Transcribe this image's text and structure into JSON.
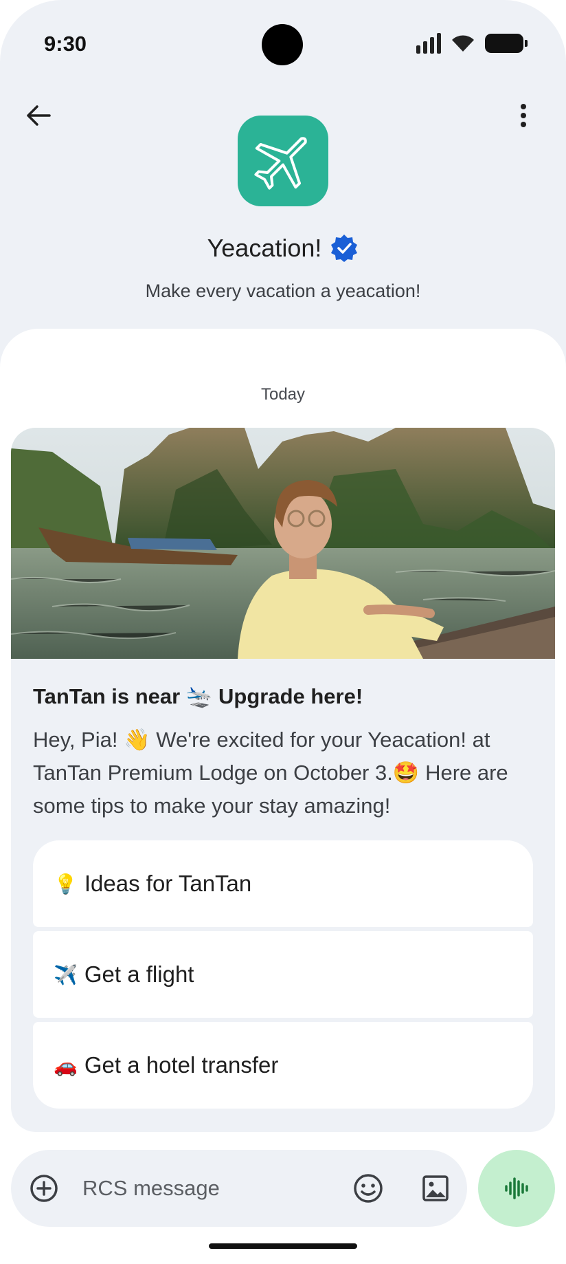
{
  "status_bar": {
    "time": "9:30",
    "icons": [
      "signal-icon",
      "wifi-icon",
      "battery-icon"
    ]
  },
  "header": {
    "back_icon": "arrow-back-icon",
    "menu_icon": "more-vert-icon",
    "logo_icon": "airplane-icon",
    "brand_name": "Yeacation!",
    "verified_icon": "verified-badge-icon",
    "tagline": "Make every vacation a yeacation!"
  },
  "chat": {
    "date_divider": "Today",
    "card": {
      "image_alt": "Woman relaxing on a boat near limestone cliffs",
      "title": "TanTan is near 🛬 Upgrade here!",
      "body": "Hey, Pia! 👋 We're excited for your Yeacation! at TanTan Premium Lodge on October 3.🤩 Here are some tips to make your stay amazing!",
      "suggestions": [
        {
          "emoji": "💡",
          "label": "Ideas for TanTan"
        },
        {
          "emoji": "✈️",
          "label": "Get a flight"
        },
        {
          "emoji": "🚗",
          "label": "Get a hotel transfer"
        }
      ]
    }
  },
  "composer": {
    "placeholder": "RCS message",
    "value": "",
    "icons": [
      "add-circle-icon",
      "emoji-icon",
      "gallery-icon",
      "voice-wave-icon"
    ]
  },
  "colors": {
    "brand": "#2bb396",
    "verified": "#1a5fd6",
    "voice_button": "#c4efcf",
    "voice_icon": "#1b7a3a",
    "surface": "#eef1f6"
  }
}
